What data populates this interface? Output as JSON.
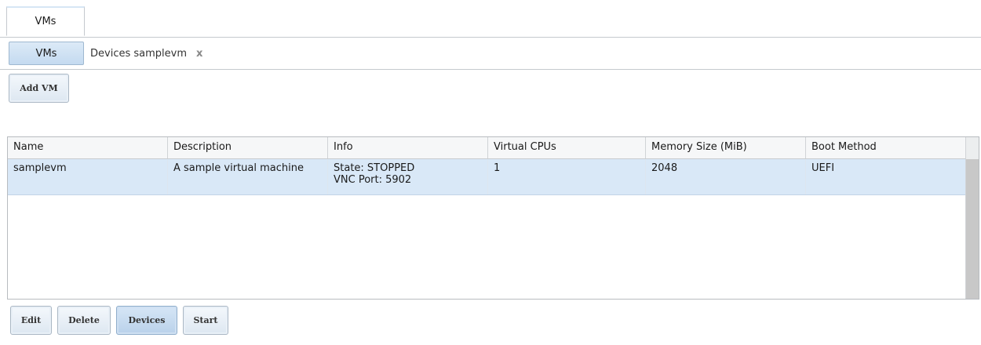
{
  "top_tabs": [
    {
      "label": "VMs"
    }
  ],
  "sub_tabs": [
    {
      "label": "VMs",
      "active": true
    },
    {
      "label": "Devices samplevm",
      "closable": true,
      "close_glyph": "x"
    }
  ],
  "toolbar": {
    "add_vm_label": "Add VM"
  },
  "table": {
    "columns": [
      "Name",
      "Description",
      "Info",
      "Virtual CPUs",
      "Memory Size (MiB)",
      "Boot Method"
    ],
    "rows": [
      {
        "name": "samplevm",
        "description": "A sample virtual machine",
        "info_line1": "State: STOPPED",
        "info_line2": "VNC Port: 5902",
        "virtual_cpus": "1",
        "memory_size": "2048",
        "boot_method": "UEFI"
      }
    ]
  },
  "actions": {
    "edit_label": "Edit",
    "delete_label": "Delete",
    "devices_label": "Devices",
    "start_label": "Start"
  },
  "colors": {
    "selected_row": "#d9e8f7",
    "active_tab": "#c4daf0"
  }
}
